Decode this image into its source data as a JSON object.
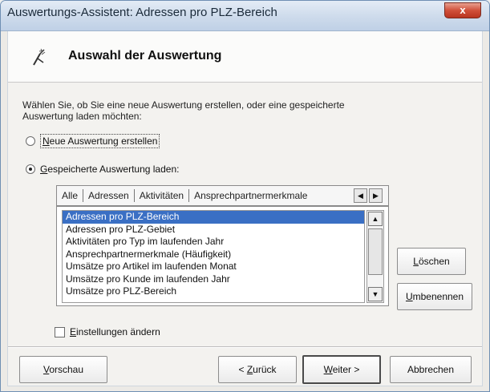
{
  "window": {
    "title": "Auswertungs-Assistent: Adressen pro PLZ-Bereich",
    "close_label": "x"
  },
  "header": {
    "icon": "wizard-icon",
    "title": "Auswahl der Auswertung"
  },
  "description": {
    "line1": "Wählen Sie, ob Sie eine neue Auswertung erstellen, oder eine gespeicherte",
    "line2": "Auswertung laden möchten:"
  },
  "options": {
    "new": {
      "mnemonic": "N",
      "rest": "eue Auswertung erstellen",
      "checked": false
    },
    "load": {
      "mnemonic": "G",
      "rest": "espeicherte Auswertung laden:",
      "checked": true
    }
  },
  "tabs": [
    {
      "label": "Alle",
      "active": true
    },
    {
      "label": "Adressen",
      "active": false
    },
    {
      "label": "Aktivitäten",
      "active": false
    },
    {
      "label": "Ansprechpartnermerkmale",
      "active": false
    }
  ],
  "list": {
    "items": [
      {
        "label": "Adressen pro PLZ-Bereich",
        "selected": true
      },
      {
        "label": "Adressen pro PLZ-Gebiet",
        "selected": false
      },
      {
        "label": "Aktivitäten pro Typ im laufenden Jahr",
        "selected": false
      },
      {
        "label": "Ansprechpartnermerkmale (Häufigkeit)",
        "selected": false
      },
      {
        "label": "Umsätze pro Artikel im laufenden Monat",
        "selected": false
      },
      {
        "label": "Umsätze pro Kunde im laufenden Jahr",
        "selected": false
      },
      {
        "label": "Umsätze pro PLZ-Bereich",
        "selected": false
      }
    ]
  },
  "side_buttons": {
    "delete": {
      "mnemonic": "L",
      "rest": "öschen"
    },
    "rename": {
      "mnemonic": "U",
      "rest": "mbenennen"
    }
  },
  "settings_checkbox": {
    "mnemonic": "E",
    "rest": "instellungen ändern",
    "checked": false
  },
  "footer": {
    "preview": {
      "mnemonic": "V",
      "rest": "orschau"
    },
    "back": {
      "prefix": "< ",
      "mnemonic": "Z",
      "rest": "urück"
    },
    "next": {
      "mnemonic": "W",
      "rest": "eiter >"
    },
    "cancel": {
      "label": "Abbrechen"
    }
  },
  "colors": {
    "selection": "#3a6fc4",
    "close_button": "#d0503a"
  }
}
